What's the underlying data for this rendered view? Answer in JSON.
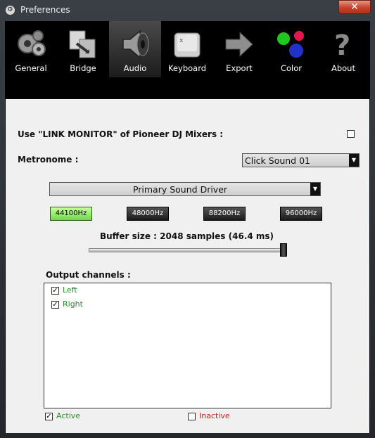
{
  "window": {
    "title": "Preferences",
    "close_glyph": "✕"
  },
  "toolbar": {
    "items": [
      {
        "label": "General",
        "icon": "gears-icon"
      },
      {
        "label": "Bridge",
        "icon": "bridge-icon"
      },
      {
        "label": "Audio",
        "icon": "speaker-icon",
        "selected": true
      },
      {
        "label": "Keyboard",
        "icon": "key-icon"
      },
      {
        "label": "Export",
        "icon": "arrow-right-icon"
      },
      {
        "label": "Color",
        "icon": "color-balls-icon"
      },
      {
        "label": "About",
        "icon": "question-mark-icon"
      }
    ]
  },
  "audio": {
    "link_monitor_label": "Use \"LINK MONITOR\" of Pioneer DJ Mixers :",
    "link_monitor_checked": false,
    "metronome_label": "Metronome :",
    "metronome_value": "Click Sound 01",
    "driver_value": "Primary Sound Driver",
    "sample_rates": [
      "44100Hz",
      "48000Hz",
      "88200Hz",
      "96000Hz"
    ],
    "selected_rate": "44100Hz",
    "buffer_label": "Buffer size : 2048 samples (46.4 ms)",
    "buffer_level": 1.0,
    "output_channels_label": "Output channels :",
    "channels": [
      {
        "name": "Left",
        "checked": true
      },
      {
        "name": "Right",
        "checked": true
      }
    ],
    "legend_active": "Active",
    "legend_inactive": "Inactive"
  },
  "colors": {
    "active_green": "#2f8a2f",
    "inactive_red": "#c0281c",
    "selected_rate_bg": "#8cf066",
    "toolbar_bg": "#000000",
    "panel_bg": "#f0f0f0"
  }
}
